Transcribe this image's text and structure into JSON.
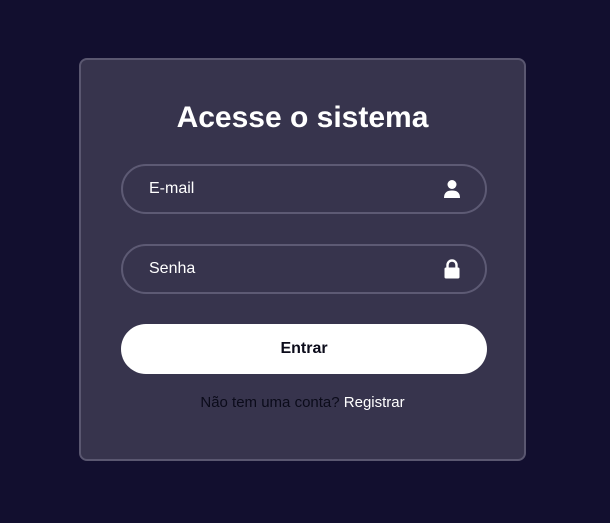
{
  "login": {
    "title": "Acesse o sistema",
    "email": {
      "placeholder": "E-mail",
      "icon": "user-icon"
    },
    "password": {
      "placeholder": "Senha",
      "icon": "lock-icon"
    },
    "submit_label": "Entrar",
    "register_prompt": "Não tem uma conta?",
    "register_link": "Registrar"
  },
  "colors": {
    "background": "#120f2f",
    "card": "#37344d",
    "card_border": "#5a5770",
    "button": "#ffffff",
    "text": "#ffffff"
  }
}
